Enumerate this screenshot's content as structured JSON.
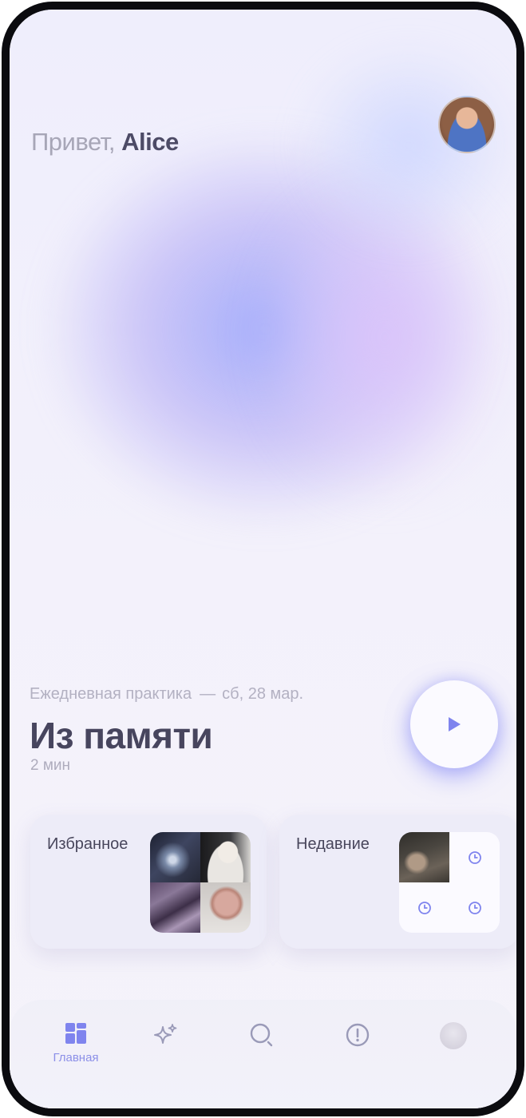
{
  "header": {
    "greeting": "Привет,",
    "user_name": "Alice"
  },
  "practice": {
    "label": "Ежедневная практика",
    "separator": "—",
    "date": "сб, 28 мар.",
    "title": "Из памяти",
    "duration": "2 мин"
  },
  "cards": {
    "favorites_label": "Избранное",
    "recent_label": "Недавние"
  },
  "nav": {
    "home_label": "Главная",
    "items": [
      "home-icon",
      "sparkles-icon",
      "search-icon",
      "alert-icon",
      "profile-avatar"
    ]
  },
  "colors": {
    "accent": "#7f84ee",
    "text_dark": "#47455e",
    "text_muted": "#b3b1c2"
  }
}
